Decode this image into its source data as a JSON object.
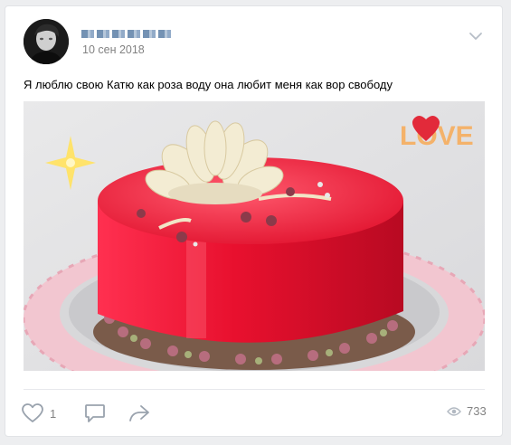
{
  "post": {
    "author_name": "",
    "date": "10 сен 2018",
    "text": "Я люблю свою Катю как роза воду она любит меня как вор свободу",
    "image": {
      "overlay_text": "LOVE",
      "colors": {
        "cake_glaze": "#e8102e",
        "background": "#e6e6e8",
        "plate": "#f2c6d0",
        "chocolate_flower": "#f3ecd3"
      }
    }
  },
  "footer": {
    "likes_count": "1",
    "views_count": "733",
    "icons": {
      "like": "heart-icon",
      "comment": "comment-icon",
      "share": "share-arrow-icon",
      "views": "eye-icon",
      "menu": "chevron-down-icon"
    }
  },
  "colors": {
    "page_bg": "#edeef0",
    "card_bg": "#ffffff",
    "muted_text": "#828282",
    "icon": "#99a2ad"
  }
}
